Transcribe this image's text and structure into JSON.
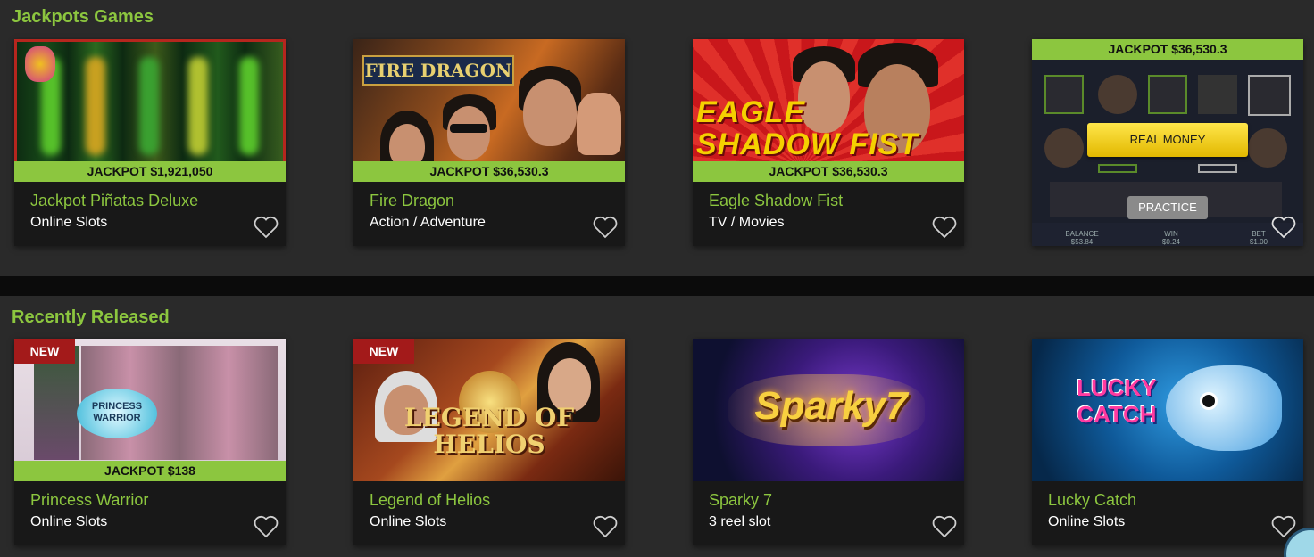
{
  "sections": [
    {
      "title": "Jackpots Games",
      "games": [
        {
          "title": "Jackpot Piñatas Deluxe",
          "category": "Online Slots",
          "jackpot": "JACKPOT $1,921,050"
        },
        {
          "title": "Fire Dragon",
          "category": "Action / Adventure",
          "jackpot": "JACKPOT $36,530.3",
          "art_text": "FIRE DRAGON"
        },
        {
          "title": "Eagle Shadow Fist",
          "category": "TV / Movies",
          "jackpot": "JACKPOT $36,530.3",
          "art_text": "EAGLE SHADOW FIST"
        },
        {
          "jackpot": "JACKPOT $36,530.3",
          "real_money": "REAL MONEY",
          "practice": "PRACTICE",
          "stats": [
            {
              "label": "BALANCE",
              "value": "$53.84"
            },
            {
              "label": "WIN",
              "value": "$0.24"
            },
            {
              "label": "BET",
              "value": "$1.00"
            }
          ]
        }
      ]
    },
    {
      "title": "Recently Released",
      "games": [
        {
          "title": "Princess Warrior",
          "category": "Online Slots",
          "jackpot": "JACKPOT $138",
          "badge": "NEW",
          "art_text": "PRINCESS WARRIOR"
        },
        {
          "title": "Legend of Helios",
          "category": "Online Slots",
          "badge": "NEW",
          "art_text": "LEGEND OF HELIOS"
        },
        {
          "title": "Sparky 7",
          "category": "3 reel slot",
          "art_text": "Sparky7"
        },
        {
          "title": "Lucky Catch",
          "category": "Online Slots",
          "art_text": "LUCKY CATCH"
        }
      ]
    }
  ],
  "icons": {
    "favorite": "heart-outline-icon"
  },
  "colors": {
    "accent": "#8cc63f",
    "background": "#2a2a2a",
    "card": "#181818",
    "badge": "#a31a1a",
    "real_money": "#f5d000"
  }
}
